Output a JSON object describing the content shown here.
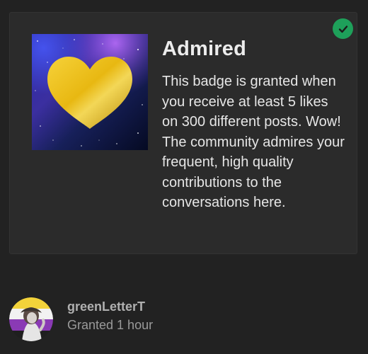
{
  "badge": {
    "title": "Admired",
    "description": "This badge is granted when you receive at least 5 likes on 300 different posts. Wow! The community admires your frequent, high quality contributions to the conversations here.",
    "image_icon": "gold-heart-icon",
    "granted_icon": "check-icon",
    "colors": {
      "card_background": "#2b2b2b",
      "check_green": "#1ea05a",
      "heart_gold": "#e8b812"
    }
  },
  "granted_user": {
    "username": "greenLetterT",
    "granted_text": "Granted 1 hour",
    "avatar_icon": "user-avatar-icon"
  }
}
